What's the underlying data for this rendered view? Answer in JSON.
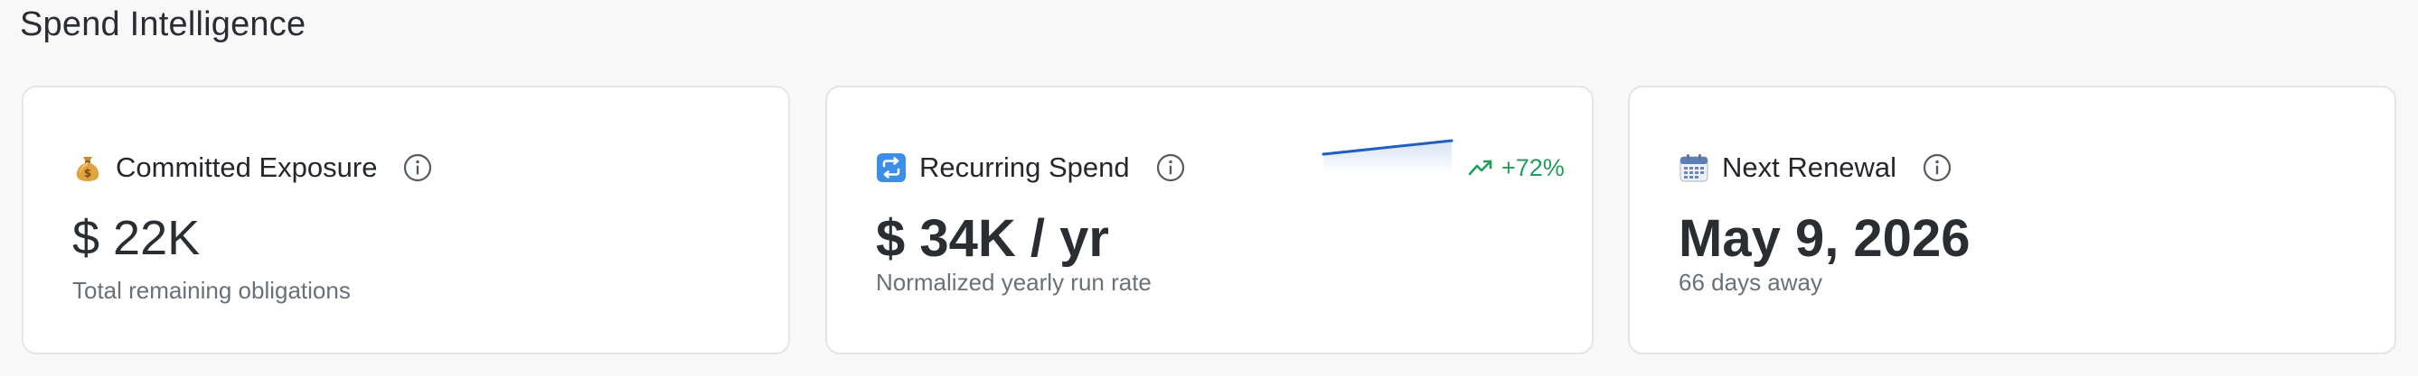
{
  "page": {
    "title": "Spend Intelligence"
  },
  "cards": [
    {
      "label": "Committed Exposure",
      "icon": "money-bag-icon",
      "value": "$ 22K",
      "subtitle": "Total remaining obligations"
    },
    {
      "label": "Recurring Spend",
      "icon": "repeat-icon",
      "value": "$ 34K / yr",
      "subtitle": "Normalized yearly run rate",
      "trend": "+72%",
      "trend_color": "#1f9d5a",
      "spark_color": "#1f5fbf"
    },
    {
      "label": "Next Renewal",
      "icon": "calendar-icon",
      "value": "May 9, 2026",
      "subtitle": "66 days away"
    }
  ]
}
